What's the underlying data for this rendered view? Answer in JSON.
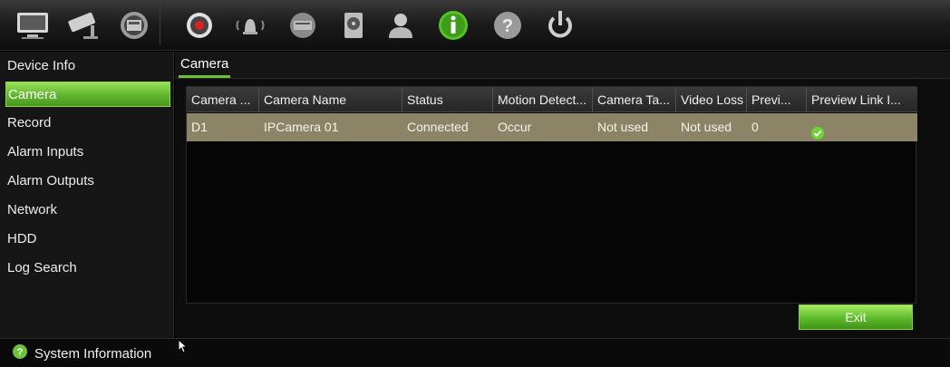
{
  "toolbar": {
    "icons": [
      {
        "name": "live-view-icon"
      },
      {
        "name": "camera-icon"
      },
      {
        "name": "network-icon"
      },
      {
        "name": "record-icon"
      },
      {
        "name": "alarm-icon"
      },
      {
        "name": "device-icon"
      },
      {
        "name": "hdd-icon"
      },
      {
        "name": "user-icon"
      },
      {
        "name": "information-icon",
        "active": true
      },
      {
        "name": "help-icon"
      },
      {
        "name": "power-icon"
      }
    ]
  },
  "sidebar": {
    "items": [
      {
        "label": "Device Info"
      },
      {
        "label": "Camera",
        "active": true
      },
      {
        "label": "Record"
      },
      {
        "label": "Alarm Inputs"
      },
      {
        "label": "Alarm Outputs"
      },
      {
        "label": "Network"
      },
      {
        "label": "HDD"
      },
      {
        "label": "Log Search"
      }
    ]
  },
  "tabs": [
    {
      "label": "Camera"
    }
  ],
  "table": {
    "columns": [
      "Camera ...",
      "Camera Name",
      "Status",
      "Motion Detect...",
      "Camera Ta...",
      "Video Loss",
      "Previ...",
      "Preview Link I..."
    ],
    "rows": [
      [
        "D1",
        "IPCamera 01",
        "Connected",
        "Occur",
        "Not used",
        "Not used",
        "0",
        "ok-icon"
      ]
    ]
  },
  "buttons": {
    "exit": "Exit"
  },
  "status_bar": {
    "label": "System Information"
  },
  "colors": {
    "accent": "#6cc236",
    "row_highlight": "#8b8466"
  }
}
